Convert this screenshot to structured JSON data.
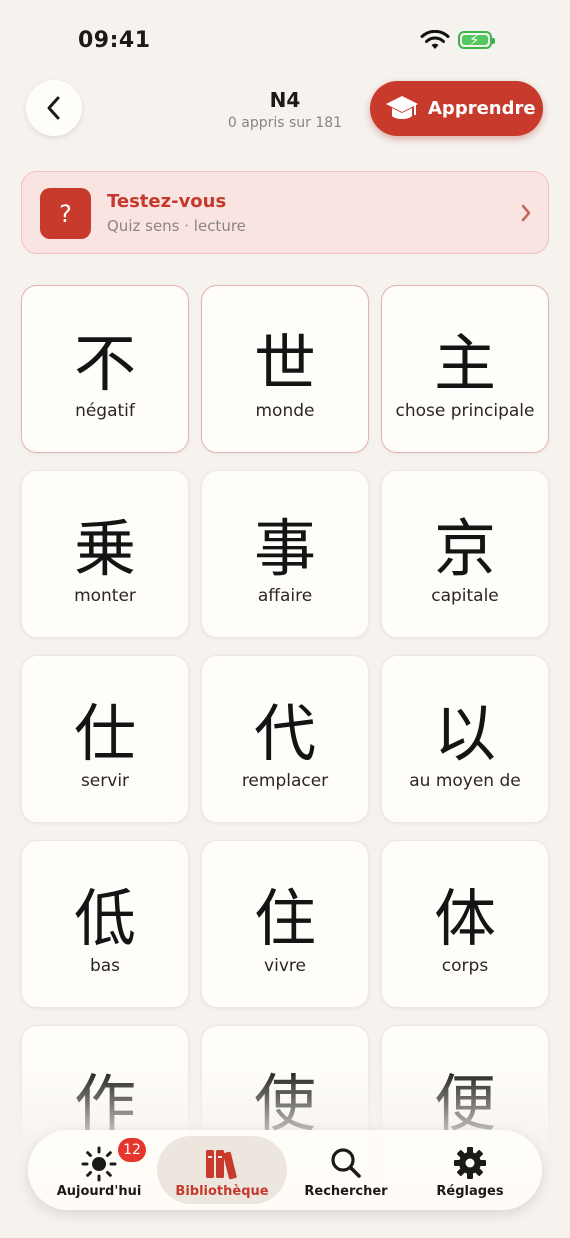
{
  "status": {
    "time": "09:41"
  },
  "header": {
    "title": "N4",
    "subtitle": "0 appris sur 181",
    "learn_label": "Apprendre"
  },
  "quiz": {
    "icon_glyph": "?",
    "title": "Testez-vous",
    "subtitle": "Quiz sens · lecture"
  },
  "kanji": [
    {
      "char": "不",
      "meaning": "négatif",
      "learned": true
    },
    {
      "char": "世",
      "meaning": "monde",
      "learned": true
    },
    {
      "char": "主",
      "meaning": "chose principale",
      "learned": true
    },
    {
      "char": "乗",
      "meaning": "monter",
      "learned": false
    },
    {
      "char": "事",
      "meaning": "affaire",
      "learned": false
    },
    {
      "char": "京",
      "meaning": "capitale",
      "learned": false
    },
    {
      "char": "仕",
      "meaning": "servir",
      "learned": false
    },
    {
      "char": "代",
      "meaning": "remplacer",
      "learned": false
    },
    {
      "char": "以",
      "meaning": "au moyen de",
      "learned": false
    },
    {
      "char": "低",
      "meaning": "bas",
      "learned": false
    },
    {
      "char": "住",
      "meaning": "vivre",
      "learned": false
    },
    {
      "char": "体",
      "meaning": "corps",
      "learned": false
    },
    {
      "char": "作",
      "meaning": "",
      "learned": false
    },
    {
      "char": "使",
      "meaning": "",
      "learned": false
    },
    {
      "char": "便",
      "meaning": "",
      "learned": false
    }
  ],
  "tabs": [
    {
      "label": "Aujourd'hui",
      "icon": "sun-icon",
      "badge": "12",
      "active": false
    },
    {
      "label": "Bibliothèque",
      "icon": "books-icon",
      "active": true
    },
    {
      "label": "Rechercher",
      "icon": "search-icon",
      "active": false
    },
    {
      "label": "Réglages",
      "icon": "gear-icon",
      "active": false
    }
  ],
  "colors": {
    "accent": "#c83a2c",
    "background": "#f6f3ef",
    "card": "#fffdf9",
    "badge": "#e5352c"
  }
}
